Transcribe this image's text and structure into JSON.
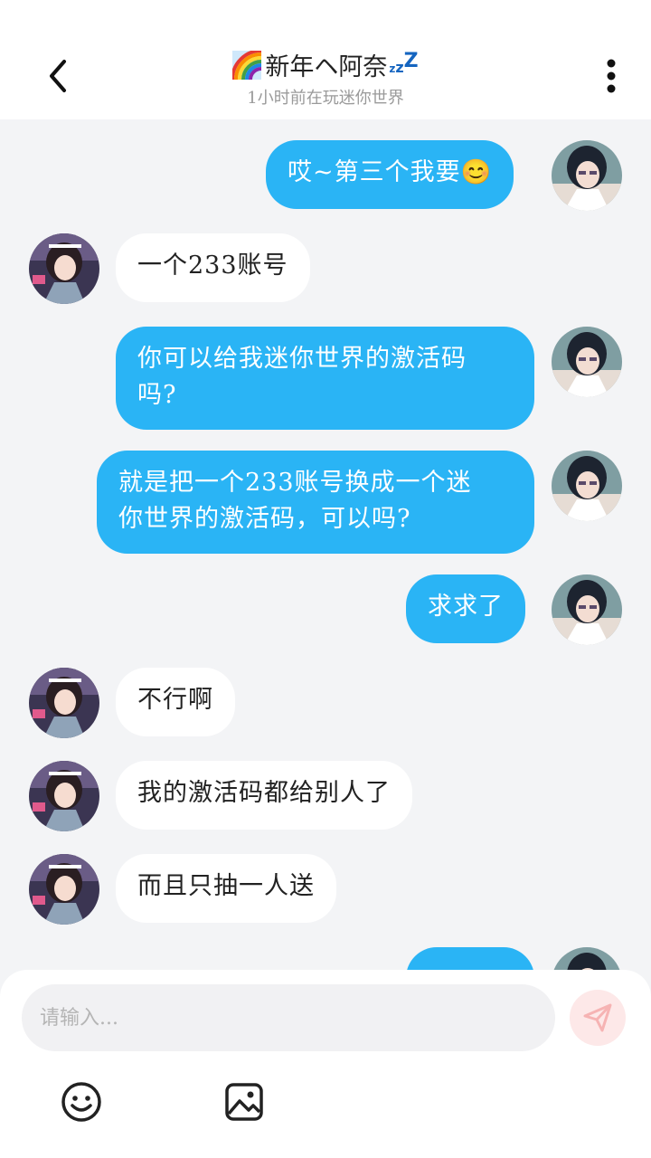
{
  "header": {
    "title": "新年ヘ阿奈",
    "zzz": [
      "z",
      "z",
      "Z"
    ],
    "status": "1小时前在玩迷你世界"
  },
  "messages": [
    {
      "side": "me",
      "text": "哎~第三个我要😊"
    },
    {
      "side": "them",
      "text": "一个233账号"
    },
    {
      "side": "me",
      "text": "你可以给我迷你世界的激活码\n吗?"
    },
    {
      "side": "me",
      "text": "就是把一个233账号换成一个迷\n你世界的激活码，可以吗?"
    },
    {
      "side": "me",
      "text": "求求了"
    },
    {
      "side": "them",
      "text": "不行啊"
    },
    {
      "side": "them",
      "text": "我的激活码都给别人了"
    },
    {
      "side": "them",
      "text": "而且只抽一人送"
    },
    {
      "side": "me",
      "text": ""
    }
  ],
  "composer": {
    "placeholder": "请输入..."
  },
  "icons": {
    "back": "chevron-left-icon",
    "more": "more-vertical-icon",
    "send": "send-icon",
    "emoji": "emoji-icon",
    "image": "image-icon"
  },
  "colors": {
    "my_bubble": "#2ab4f5",
    "their_bubble": "#ffffff",
    "background": "#f3f4f6",
    "send_button": "#fde8e8"
  }
}
